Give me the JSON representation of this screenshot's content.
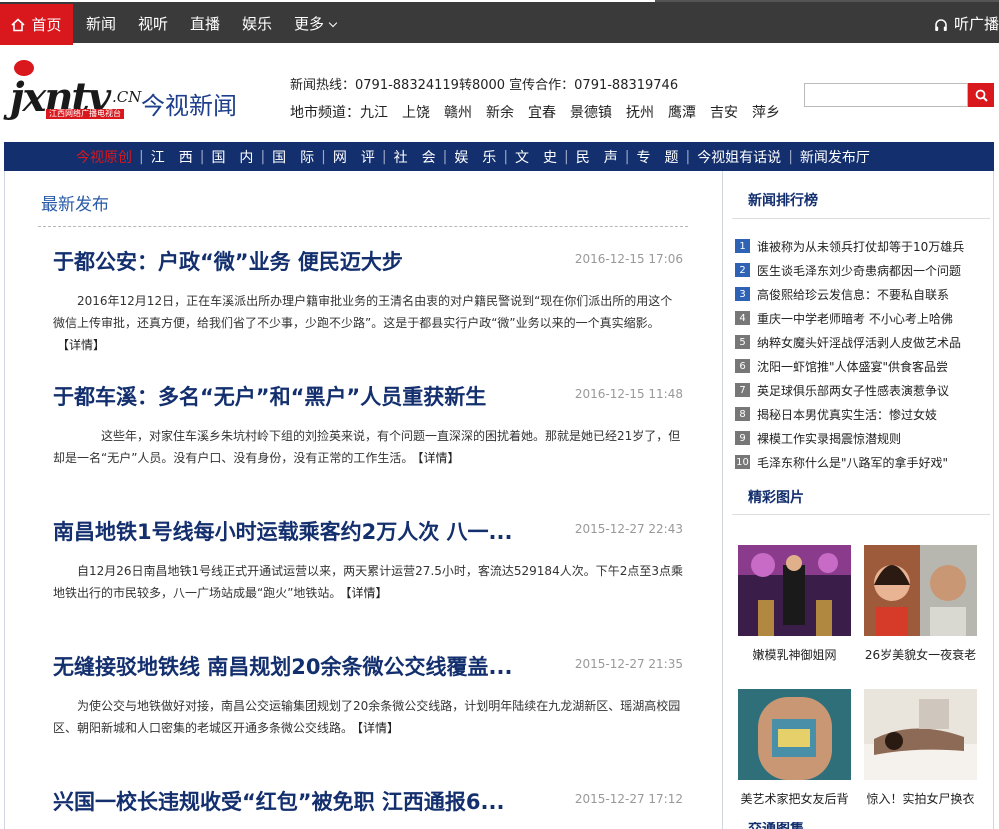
{
  "topnav": {
    "home": "首页",
    "items": [
      "新闻",
      "视听",
      "直播",
      "娱乐",
      "更多"
    ],
    "radio": "听广播"
  },
  "logo": {
    "main": "jxntv",
    "suffix": ".CN",
    "tagline": "江西网络广播电视台",
    "brand": "今视新闻"
  },
  "header": {
    "hotline": "新闻热线：0791-88324119转8000 宣传合作：0791-88319746",
    "cities_label": "地市频道：",
    "cities": [
      "九江",
      "上饶",
      "赣州",
      "新余",
      "宜春",
      "景德镇",
      "抚州",
      "鹰潭",
      "吉安",
      "萍乡"
    ]
  },
  "search": {
    "placeholder": ""
  },
  "channels": [
    "今视原创",
    "江　西",
    "国　内",
    "国　际",
    "网　评",
    "社　会",
    "娱　乐",
    "文　史",
    "民　声",
    "专　题",
    "今视姐有话说",
    "新闻发布厅"
  ],
  "main": {
    "section_title": "最新发布",
    "articles": [
      {
        "title": "于都公安：户政“微”业务 便民迈大步",
        "date": "2016-12-15 17:06",
        "summary": "2016年12月12日，正在车溪派出所办理户籍审批业务的王清名由衷的对户籍民警说到“现在你们派出所的用这个微信上传审批，还真方便，给我们省了不少事，少跑不少路”。这是于都县实行户政“微”业务以来的一个真实缩影。",
        "more": "【详情】"
      },
      {
        "title": "于都车溪：多名“无户”和“黑户”人员重获新生",
        "date": "2016-12-15 11:48",
        "summary": "　　这些年，对家住车溪乡朱坑村岭下组的刘捡英来说，有个问题一直深深的困扰着她。那就是她已经21岁了，但却是一名“无户”人员。没有户口、没有身份，没有正常的工作生活。",
        "more": "【详情】"
      },
      {
        "title": "南昌地铁1号线每小时运载乘客约2万人次 八一...",
        "date": "2015-12-27 22:43",
        "summary": "自12月26日南昌地铁1号线正式开通试运营以来，两天累计运营27.5小时，客流达529184人次。下午2点至3点乘地铁出行的市民较多，八一广场站成最“跑火”地铁站。",
        "more": "【详情】"
      },
      {
        "title": "无缝接驳地铁线 南昌规划20余条微公交线覆盖...",
        "date": "2015-12-27 21:35",
        "summary": "为使公交与地铁做好对接，南昌公交运输集团规划了20余条微公交线路，计划明年陆续在九龙湖新区、瑶湖高校园区、朝阳新城和人口密集的老城区开通多条微公交线路。",
        "more": "【详情】"
      },
      {
        "title": "兴国一校长违规收受“红包”被免职 江西通报6...",
        "date": "2015-12-27 17:12",
        "summary": "",
        "more": ""
      }
    ]
  },
  "sidebar": {
    "rank_title": "新闻排行榜",
    "rank": [
      {
        "num": "1",
        "text": "谁被称为从未领兵打仗却等于10万雄兵"
      },
      {
        "num": "2",
        "text": "医生谈毛泽东刘少奇患病都因一个问题"
      },
      {
        "num": "3",
        "text": "高俊熙给珍云发信息：不要私自联系"
      },
      {
        "num": "4",
        "text": "重庆一中学老师暗考 不小心考上哈佛"
      },
      {
        "num": "5",
        "text": "纳粹女魔头奸淫战俘活剥人皮做艺术品"
      },
      {
        "num": "6",
        "text": "沈阳一虾馆推\"人体盛宴\"供食客品尝"
      },
      {
        "num": "7",
        "text": "英足球俱乐部两女子性感表演惹争议"
      },
      {
        "num": "8",
        "text": "揭秘日本男优真实生活：惨过女妓"
      },
      {
        "num": "9",
        "text": "裸模工作实录揭震惊潜规则"
      },
      {
        "num": "10",
        "text": "毛泽东称什么是\"八路军的拿手好戏\""
      }
    ],
    "pic_title": "精彩图片",
    "pics": [
      {
        "caption": "嫩模乳神御姐网"
      },
      {
        "caption": "26岁美貌女一夜衰老"
      },
      {
        "caption": "美艺术家把女友后背"
      },
      {
        "caption": "惊入！实拍女尸换衣"
      }
    ],
    "next_title": "交通图集"
  },
  "colors": {
    "accent_red": "#d8181c",
    "nav_blue": "#132f6e",
    "title_blue": "#2a5ba8"
  }
}
